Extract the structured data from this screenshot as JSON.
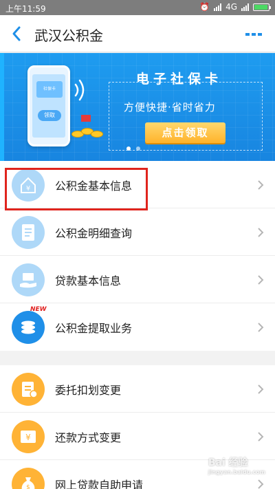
{
  "status_bar": {
    "time": "上午11:59",
    "network": "4G",
    "battery_level": 0.85
  },
  "nav": {
    "title": "武汉公积金"
  },
  "banner": {
    "phone_card_text": "社保卡",
    "phone_button_text": "领取",
    "title": "电子社保卡",
    "subtitle": "方便快捷·省时省力",
    "cta_label": "点击领取"
  },
  "menu_group_1": [
    {
      "label": "公积金基本信息",
      "icon": "house-coin-icon",
      "color": "#aed8f8"
    },
    {
      "label": "公积金明细查询",
      "icon": "document-icon",
      "color": "#aed8f8"
    },
    {
      "label": "贷款基本信息",
      "icon": "hand-money-icon",
      "color": "#aed8f8"
    },
    {
      "label": "公积金提取业务",
      "icon": "coins-stack-icon",
      "color": "#1f8fe8",
      "badge": "NEW"
    }
  ],
  "menu_group_2": [
    {
      "label": "委托扣划变更",
      "icon": "form-edit-icon",
      "color": "#ffb336"
    },
    {
      "label": "还款方式变更",
      "icon": "yuan-card-icon",
      "color": "#ffb336"
    },
    {
      "label": "网上贷款自助申请",
      "icon": "money-bag-icon",
      "color": "#ffb336"
    }
  ],
  "watermark": {
    "text": "Bai 经验",
    "sub": "jingyan.baidu.com"
  }
}
